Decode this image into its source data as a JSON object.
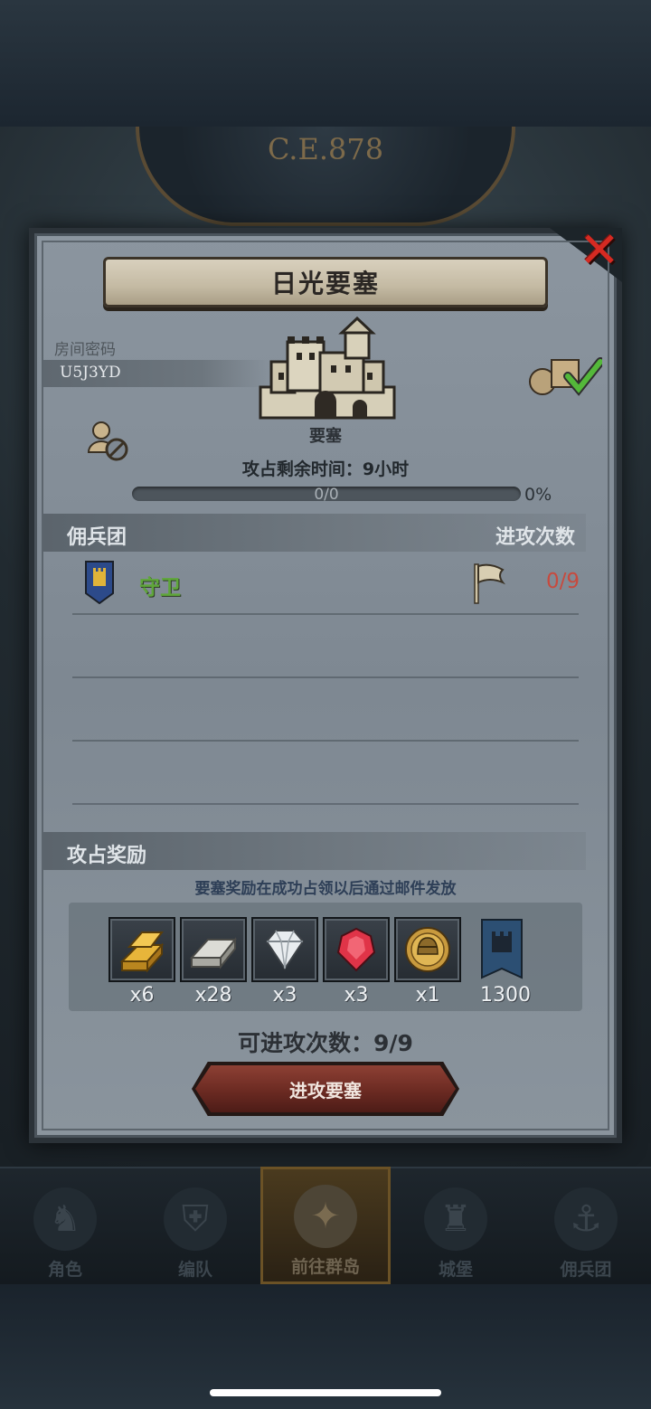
{
  "header": {
    "year": "C.E.878"
  },
  "modal": {
    "title": "日光要塞",
    "room_label": "房间密码",
    "room_code": "U5J3YD",
    "fortress_label": "要塞",
    "time_remaining": "攻占剩余时间：9小时",
    "progress": {
      "count_text": "0/0",
      "percent_text": "0%",
      "fraction": 0
    },
    "mercenary_header": "佣兵团",
    "attack_count_header": "进攻次数",
    "guard_row": {
      "name": "守卫",
      "count": "0/9"
    },
    "reward_header": "攻占奖励",
    "reward_note": "要塞奖励在成功占领以后通过邮件发放",
    "rewards": [
      {
        "icon": "gold-bars-icon",
        "qty": "x6"
      },
      {
        "icon": "silver-ingot-icon",
        "qty": "x28"
      },
      {
        "icon": "diamond-icon",
        "qty": "x3"
      },
      {
        "icon": "ruby-icon",
        "qty": "x3"
      },
      {
        "icon": "gold-helmet-coin-icon",
        "qty": "x1"
      },
      {
        "icon": "banner-token-icon",
        "qty": "1300"
      }
    ],
    "available_attacks": "可进攻次数：9/9",
    "attack_button": "进攻要塞"
  },
  "nav": [
    {
      "label": "角色",
      "icon": "knight-icon"
    },
    {
      "label": "编队",
      "icon": "helmet-icon"
    },
    {
      "label": "前往群岛",
      "icon": "compass-map-icon",
      "active": true
    },
    {
      "label": "城堡",
      "icon": "castle-icon"
    },
    {
      "label": "佣兵团",
      "icon": "ship-icon"
    }
  ],
  "colors": {
    "guard_name": "#5fa63a",
    "attack_count": "#c74a3e",
    "close_x": "#d52a22",
    "button_red": "#6b2a22"
  }
}
